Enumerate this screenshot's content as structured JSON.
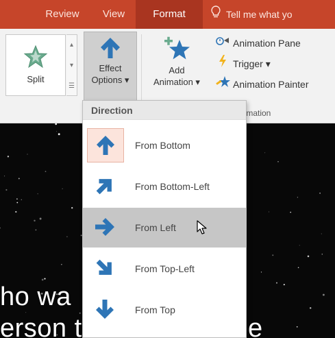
{
  "tabs": {
    "review": "Review",
    "view": "View",
    "format": "Format",
    "tell_me": "Tell me what yo"
  },
  "ribbon": {
    "gallery": {
      "selected_effect": "Split"
    },
    "effect_options": {
      "line1": "Effect",
      "line2": "Options ▾"
    },
    "add_animation": {
      "line1": "Add",
      "line2": "Animation ▾"
    },
    "animation_pane": "Animation Pane",
    "trigger": "Trigger ▾",
    "animation_painter": "Animation Painter",
    "group_label": "nimation"
  },
  "dropdown": {
    "header": "Direction",
    "items": [
      {
        "label": "From Bottom",
        "icon": "arrow-up-icon",
        "current": true
      },
      {
        "label": "From Bottom-Left",
        "icon": "arrow-up-right-icon",
        "current": false
      },
      {
        "label": "From Left",
        "icon": "arrow-right-icon",
        "current": false,
        "hovered": true
      },
      {
        "label": "From Top-Left",
        "icon": "arrow-down-right-icon",
        "current": false
      },
      {
        "label": "From Top",
        "icon": "arrow-down-icon",
        "current": false
      }
    ]
  },
  "slide": {
    "line1": "ho wa",
    "line2": "erson t",
    "line2_tail": "e"
  },
  "colors": {
    "accent": "#c6452a",
    "format_tab": "#a93520",
    "arrow_blue": "#2e75b6",
    "star_green": "#6aab8e",
    "selection_gray": "#c6c6c6"
  }
}
